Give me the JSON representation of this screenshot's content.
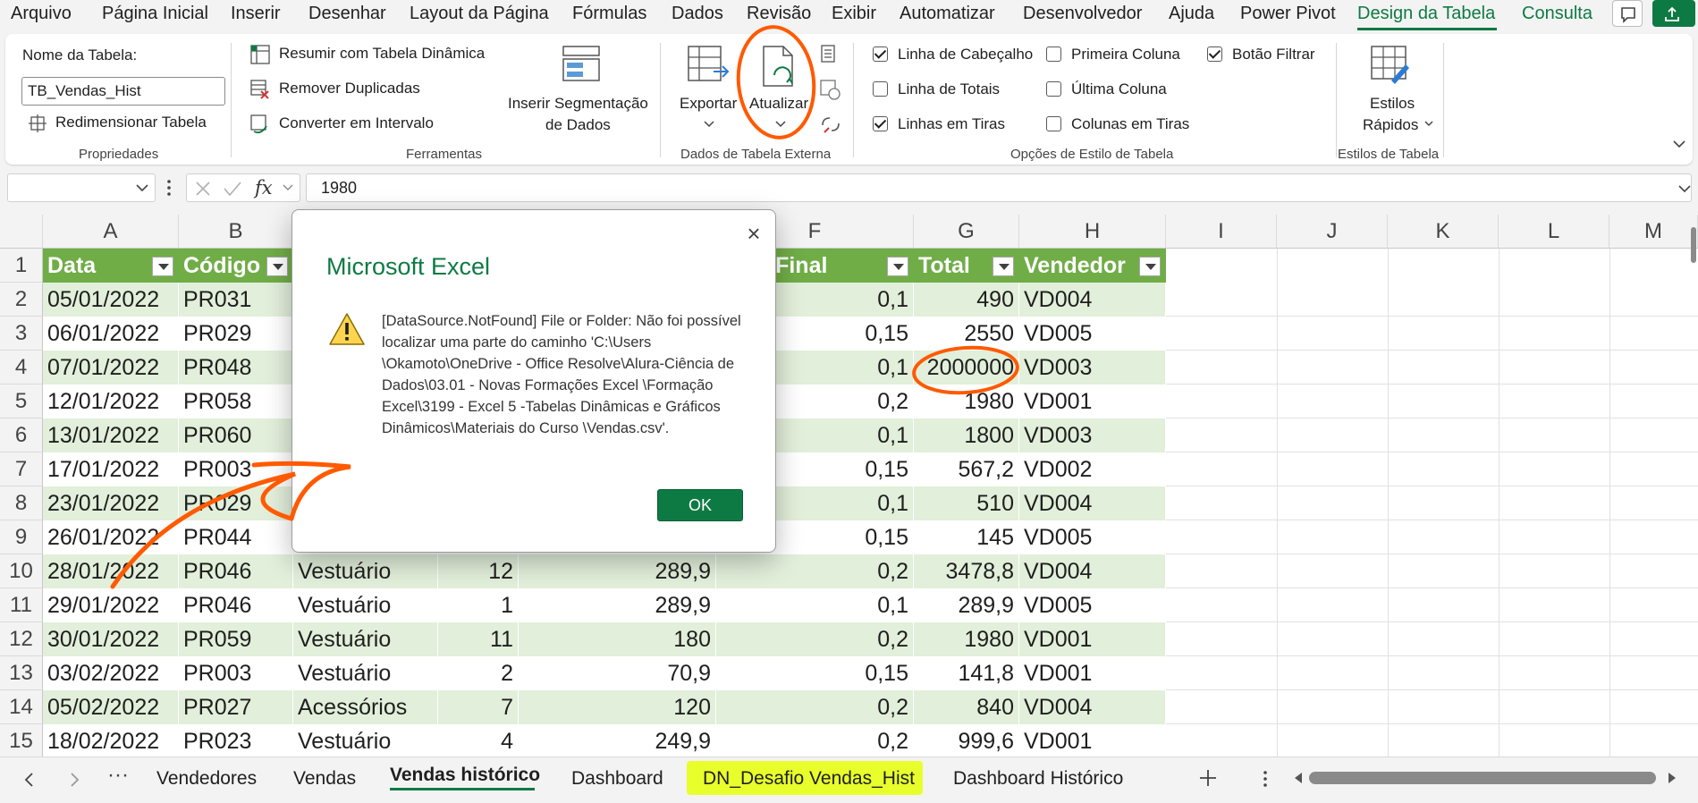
{
  "menu": {
    "items": [
      "Arquivo",
      "Página Inicial",
      "Inserir",
      "Desenhar",
      "Layout da Página",
      "Fórmulas",
      "Dados",
      "Revisão",
      "Exibir",
      "Automatizar",
      "Desenvolvedor",
      "Ajuda",
      "Power Pivot",
      "Design da Tabela",
      "Consulta"
    ],
    "active": "Design da Tabela"
  },
  "ribbon": {
    "properties": {
      "name_label": "Nome da Tabela:",
      "table_name": "TB_Vendas_Hist",
      "resize_label": "Redimensionar Tabela",
      "group_label": "Propriedades"
    },
    "tools": {
      "summarize_pivot": "Resumir com Tabela Dinâmica",
      "remove_duplicates": "Remover Duplicadas",
      "convert_range": "Converter em Intervalo",
      "insert_slicer_line1": "Inserir Segmentação",
      "insert_slicer_line2": "de Dados",
      "group_label": "Ferramentas"
    },
    "external": {
      "export": "Exportar",
      "refresh": "Atualizar",
      "group_label": "Dados de Tabela Externa"
    },
    "style_options": {
      "header_row": "Linha de Cabeçalho",
      "total_row": "Linha de Totais",
      "banded_rows": "Linhas em Tiras",
      "first_column": "Primeira Coluna",
      "last_column": "Última Coluna",
      "banded_columns": "Colunas em Tiras",
      "filter_button": "Botão Filtrar",
      "group_label": "Opções de Estilo de Tabela",
      "checked": {
        "header_row": true,
        "total_row": false,
        "banded_rows": true,
        "first_column": false,
        "last_column": false,
        "banded_columns": false,
        "filter_button": true
      }
    },
    "styles": {
      "quick_styles_line1": "Estilos",
      "quick_styles_line2": "Rápidos",
      "group_label": "Estilos de Tabela"
    }
  },
  "formula_bar": {
    "value": "1980"
  },
  "grid": {
    "column_letters": [
      "A",
      "B",
      "F",
      "G",
      "H",
      "I",
      "J",
      "K",
      "L",
      "M"
    ],
    "row_numbers": [
      "1",
      "2",
      "3",
      "4",
      "5",
      "6",
      "7",
      "8",
      "9",
      "10",
      "11",
      "12",
      "13",
      "14",
      "15"
    ],
    "headers": {
      "A": "Data",
      "B": "Código",
      "F": "onto Final",
      "G": "Total",
      "H": "Vendedor"
    },
    "rows": [
      {
        "A": "05/01/2022",
        "B": "PR031",
        "C": "",
        "D": "",
        "E": "",
        "F": "0,1",
        "G": "490",
        "H": "VD004"
      },
      {
        "A": "06/01/2022",
        "B": "PR029",
        "C": "",
        "D": "",
        "E": "",
        "F": "0,15",
        "G": "2550",
        "H": "VD005"
      },
      {
        "A": "07/01/2022",
        "B": "PR048",
        "C": "",
        "D": "",
        "E": "",
        "F": "0,1",
        "G": "2000000",
        "H": "VD003"
      },
      {
        "A": "12/01/2022",
        "B": "PR058",
        "C": "",
        "D": "",
        "E": "",
        "F": "0,2",
        "G": "1980",
        "H": "VD001"
      },
      {
        "A": "13/01/2022",
        "B": "PR060",
        "C": "",
        "D": "",
        "E": "",
        "F": "0,1",
        "G": "1800",
        "H": "VD003"
      },
      {
        "A": "17/01/2022",
        "B": "PR003",
        "C": "",
        "D": "",
        "E": "",
        "F": "0,15",
        "G": "567,2",
        "H": "VD002"
      },
      {
        "A": "23/01/2022",
        "B": "PR029",
        "C": "",
        "D": "",
        "E": "",
        "F": "0,1",
        "G": "510",
        "H": "VD004"
      },
      {
        "A": "26/01/2022",
        "B": "PR044",
        "C": "",
        "D": "",
        "E": "",
        "F": "0,15",
        "G": "145",
        "H": "VD005"
      },
      {
        "A": "28/01/2022",
        "B": "PR046",
        "C": "Vestuário",
        "D": "12",
        "E": "289,9",
        "F": "0,2",
        "G": "3478,8",
        "H": "VD004"
      },
      {
        "A": "29/01/2022",
        "B": "PR046",
        "C": "Vestuário",
        "D": "1",
        "E": "289,9",
        "F": "0,1",
        "G": "289,9",
        "H": "VD005"
      },
      {
        "A": "30/01/2022",
        "B": "PR059",
        "C": "Vestuário",
        "D": "11",
        "E": "180",
        "F": "0,2",
        "G": "1980",
        "H": "VD001"
      },
      {
        "A": "03/02/2022",
        "B": "PR003",
        "C": "Vestuário",
        "D": "2",
        "E": "70,9",
        "F": "0,15",
        "G": "141,8",
        "H": "VD001"
      },
      {
        "A": "05/02/2022",
        "B": "PR027",
        "C": "Acessórios",
        "D": "7",
        "E": "120",
        "F": "0,2",
        "G": "840",
        "H": "VD004"
      },
      {
        "A": "18/02/2022",
        "B": "PR023",
        "C": "Vestuário",
        "D": "4",
        "E": "249,9",
        "F": "0,2",
        "G": "999,6",
        "H": "VD001"
      }
    ]
  },
  "sheet_tabs": {
    "items": [
      "Vendedores",
      "Vendas",
      "Vendas histórico",
      "Dashboard",
      "DN_Desafio Vendas_Hist",
      "Dashboard Histórico"
    ],
    "active": "Vendas histórico",
    "highlighted": "DN_Desafio Vendas_Hist"
  },
  "dialog": {
    "title": "Microsoft Excel",
    "message": "[DataSource.NotFound] File or Folder: Não foi possível localizar uma parte do caminho 'C:\\Users \\Okamoto\\OneDrive - Office Resolve\\Alura-Ciência de Dados\\03.01 - Novas Formações Excel \\Formação Excel\\3199 - Excel 5 -Tabelas Dinâmicas e Gráficos Dinâmicos\\Materiais do Curso \\Vendas.csv'.",
    "ok_label": "OK",
    "close_glyph": "×",
    "icon": "warning-icon"
  },
  "colors": {
    "accent": "#0e7a43",
    "table_header": "#70ad47",
    "band": "#e2efda",
    "annotation": "#ff5a00",
    "tab_highlight": "#e8ff2c"
  }
}
